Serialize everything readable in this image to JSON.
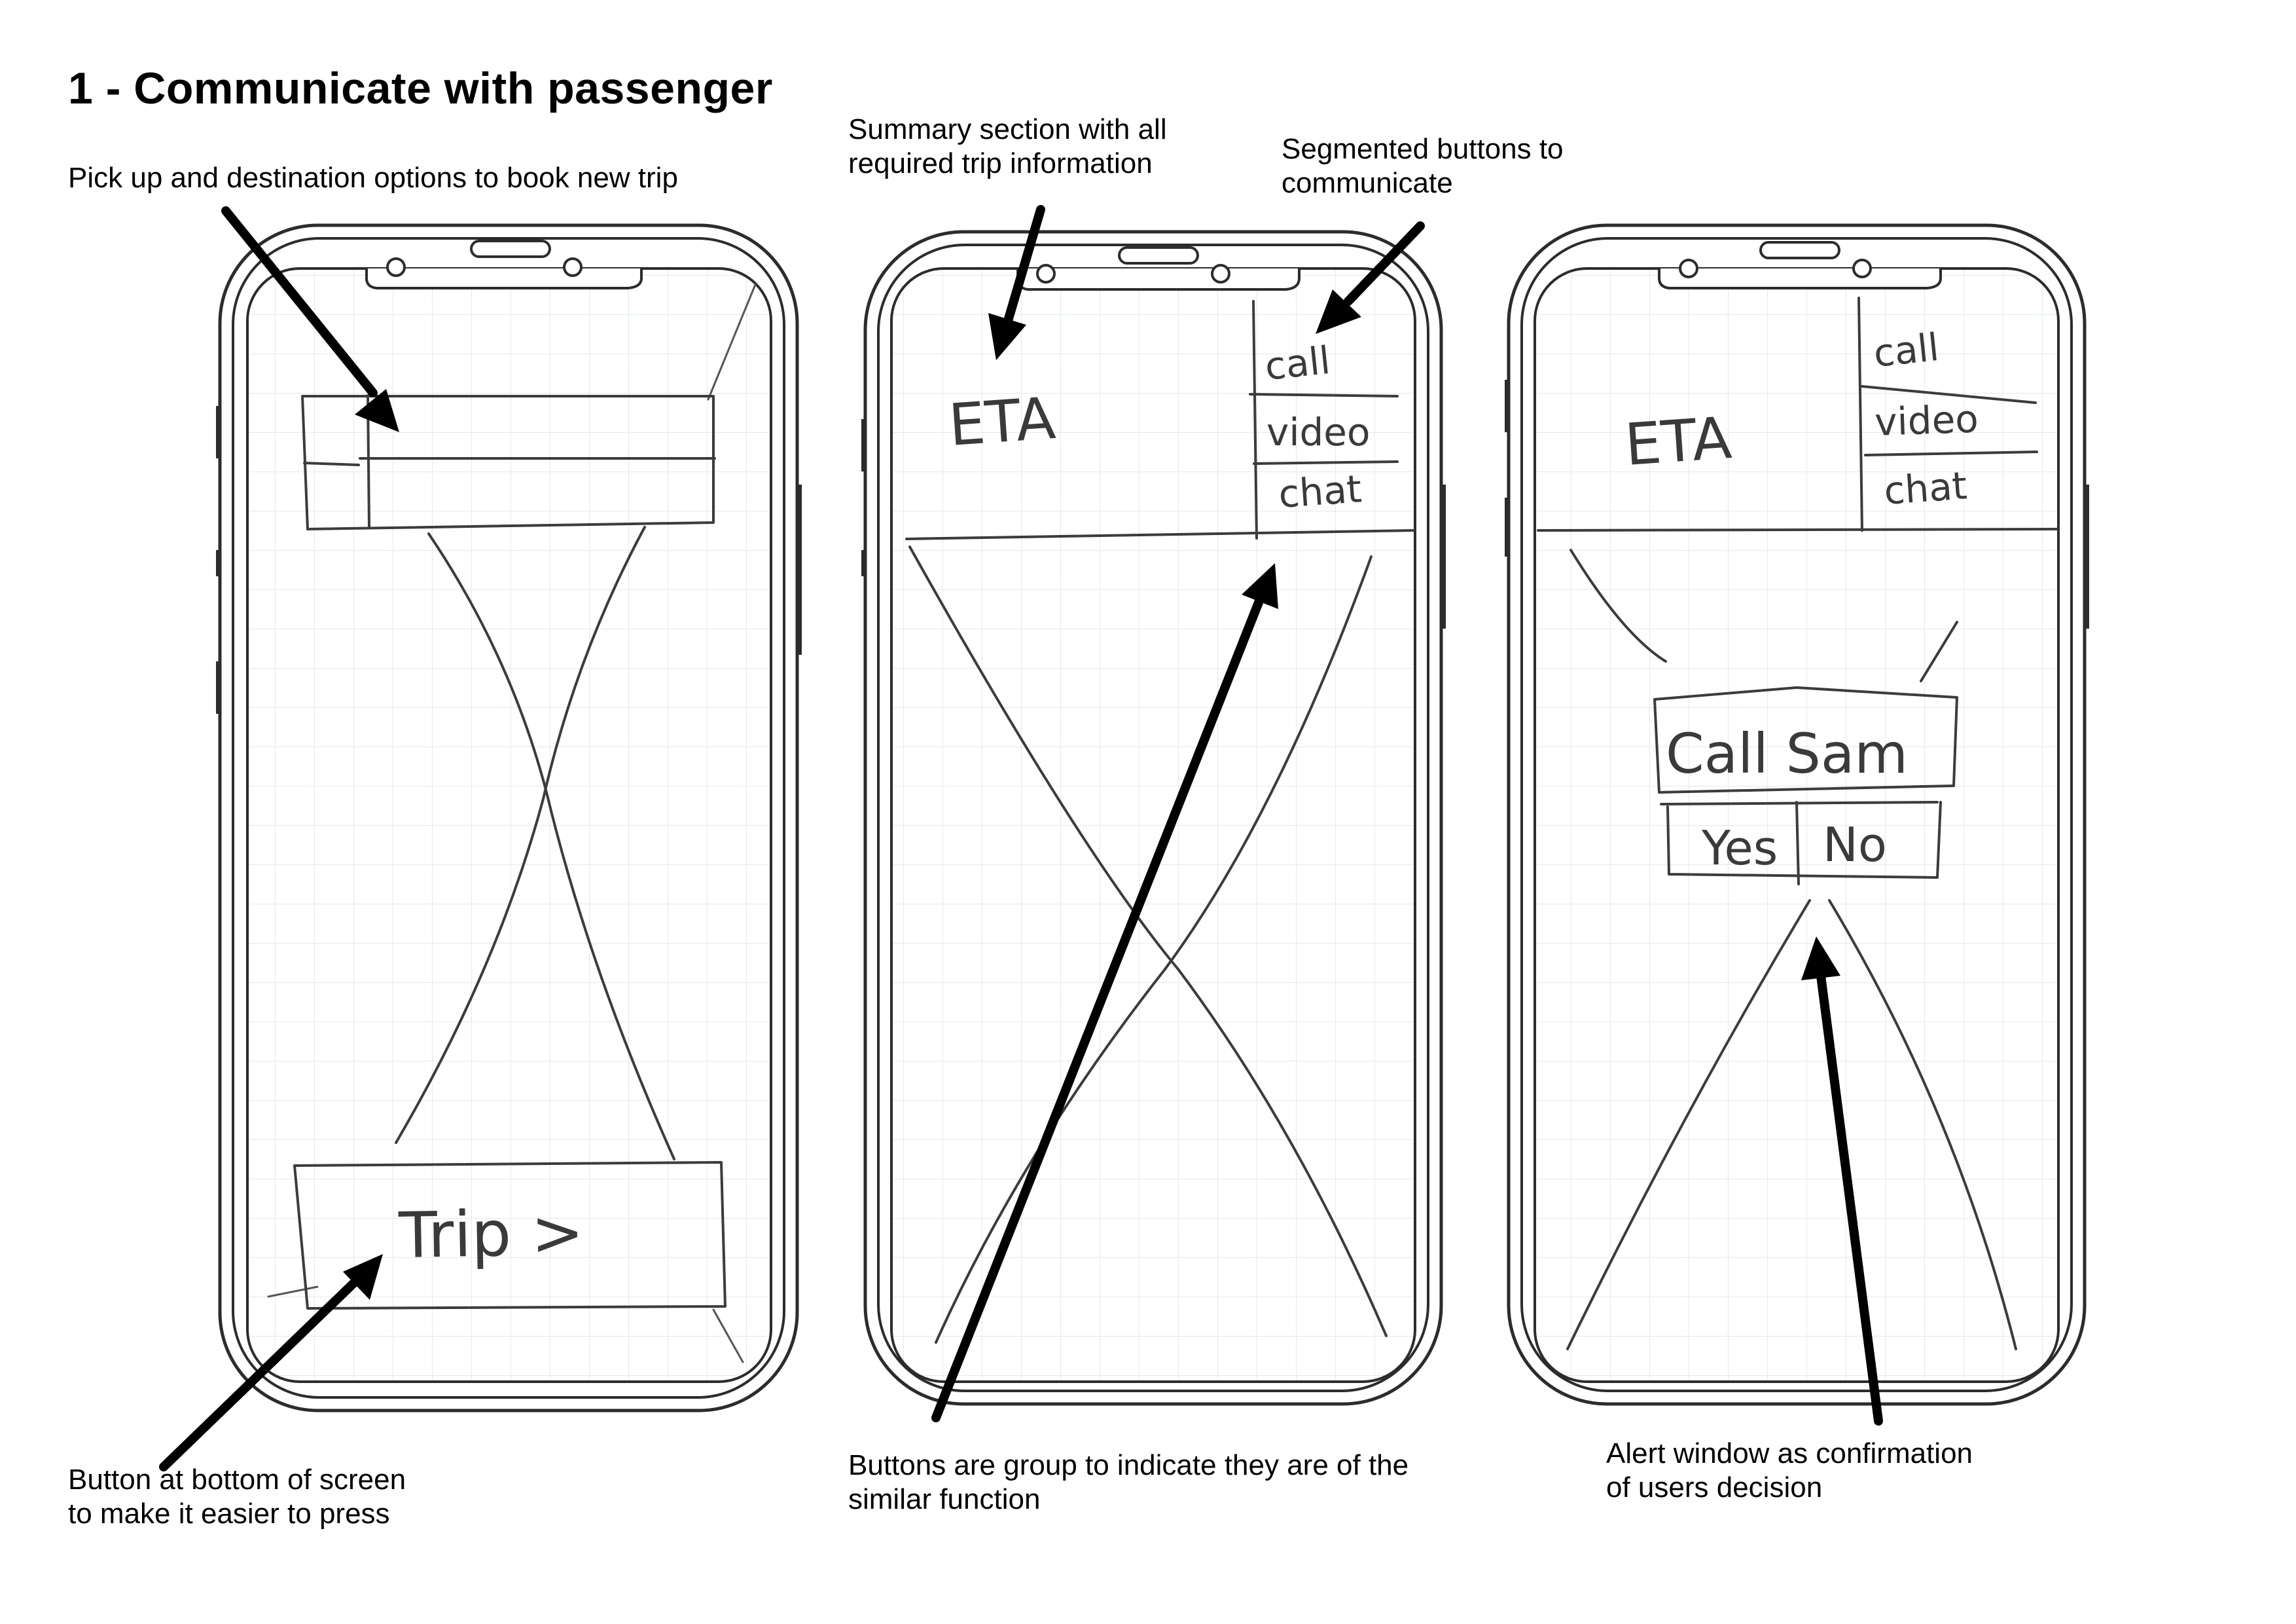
{
  "title": "1 - Communicate with passenger",
  "annotations": {
    "pickup": [
      "Pick up and destination options to book new trip"
    ],
    "summary": [
      "Summary section with all",
      "required trip information"
    ],
    "segmented": [
      "Segmented buttons to",
      "communicate"
    ],
    "bottom_button": [
      "Button at bottom of screen",
      "to make it easier to press"
    ],
    "grouped": [
      "Buttons are group to indicate they are of the",
      "similar function"
    ],
    "alert": [
      "Alert window as confirmation",
      "of users decision"
    ]
  },
  "screen1": {
    "trip_button": "Trip >"
  },
  "screen2": {
    "eta": "ETA",
    "segments": [
      "call",
      "video",
      "chat"
    ]
  },
  "screen3": {
    "eta": "ETA",
    "segments": [
      "call",
      "video",
      "chat"
    ],
    "alert": {
      "title": "Call Sam",
      "yes": "Yes",
      "no": "No"
    }
  },
  "colors": {
    "ink": "#000000",
    "pencil": "#3c3c3c",
    "grid": "#e4e8ee",
    "frame": "#2c2c2c"
  },
  "icons": [
    "arrow-icon",
    "camera-dot-icon",
    "speaker-icon"
  ]
}
